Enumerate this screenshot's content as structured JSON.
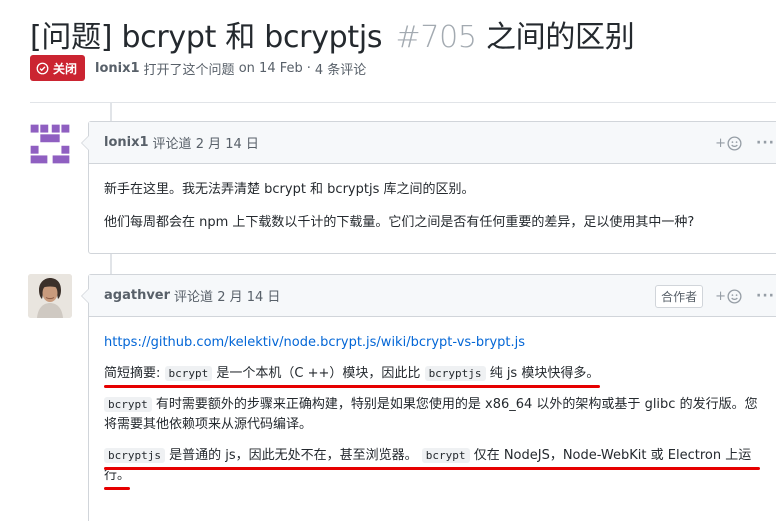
{
  "issue": {
    "title": "[问题] bcrypt 和 bcryptjs",
    "number": "#705",
    "title_suffix": "之间的区别",
    "state_label": "关闭",
    "author": "lonix1",
    "opened_text": "打开了这个问题",
    "opened_prefix": "on",
    "opened_date": "14 Feb",
    "separator": "·",
    "comment_count": "4 条评论"
  },
  "comments": [
    {
      "author": "lonix1",
      "action": "评论道",
      "date": "2 月 14 日",
      "reaction_label": "+",
      "more_label": "···",
      "paragraphs": [
        "新手在这里。我无法弄清楚 bcrypt 和 bcryptjs 库之间的区别。",
        "他们每周都会在 npm 上下载数以千计的下载量。它们之间是否有任何重要的差异，足以使用其中一种?"
      ]
    },
    {
      "author": "agathver",
      "action": "评论道",
      "date": "2 月 14 日",
      "badge": "合作者",
      "reaction_label": "+",
      "more_label": "···",
      "link": "https://github.com/kelektiv/node.bcrypt.js/wiki/bcrypt-vs-brypt.js",
      "p1": {
        "prefix": "简短摘要:",
        "code1": "bcrypt",
        "mid": "是一个本机（C ++）模块，因此比",
        "code2": "bcryptjs",
        "suffix": "纯 js 模块快得多。"
      },
      "p2": {
        "code": "bcrypt",
        "text": "有时需要额外的步骤来正确构建，特别是如果您使用的是 x86_64 以外的架构或基于 glibc 的发行版。您将需要其他依赖项来从源代码编译。"
      },
      "p3": {
        "code1": "bcryptjs",
        "text1": "是普通的 js，因此无处不在，甚至浏览器。",
        "code2": "bcrypt",
        "text2": "仅在 NodeJS，Node-WebKit 或 Electron 上运行。"
      }
    }
  ],
  "colors": {
    "closed": "#cb2431",
    "link": "#0366d6",
    "annotation": "#e60000"
  },
  "icons": {
    "state": "issue-closed-icon",
    "reaction": "smiley-icon",
    "more": "kebab-icon"
  }
}
